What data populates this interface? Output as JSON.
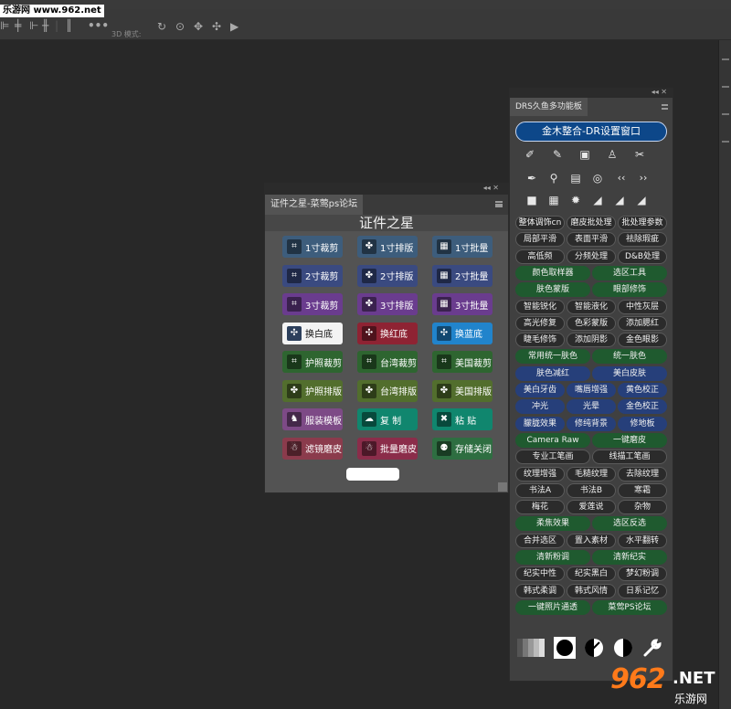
{
  "watermark_top": "乐游网 www.962.net",
  "options_bar": {
    "mode_label": "3D 模式:"
  },
  "panel1": {
    "tab": "证件之星-菜莺ps论坛",
    "title": "证件之星",
    "rows": [
      [
        {
          "label": "1寸裁剪",
          "color": "#3d5d7c",
          "icon": "crop-icon"
        },
        {
          "label": "1寸排版",
          "color": "#3d5d7c",
          "icon": "layout-icon"
        },
        {
          "label": "1寸批量",
          "color": "#3d5d7c",
          "icon": "batch-icon"
        }
      ],
      [
        {
          "label": "2寸裁剪",
          "color": "#3a4a80",
          "icon": "crop-icon"
        },
        {
          "label": "2寸排版",
          "color": "#3a4a80",
          "icon": "layout-icon"
        },
        {
          "label": "2寸批量",
          "color": "#3a4a80",
          "icon": "batch-icon"
        }
      ],
      [
        {
          "label": "3寸裁剪",
          "color": "#6a3c8e",
          "icon": "crop-icon"
        },
        {
          "label": "3寸排版",
          "color": "#6a3c8e",
          "icon": "layout-icon"
        },
        {
          "label": "3寸批量",
          "color": "#6a3c8e",
          "icon": "batch-icon"
        }
      ],
      [
        {
          "label": "换白底",
          "color": "#f3f3f3",
          "text": "#111",
          "icon": "swap-white-icon"
        },
        {
          "label": "换红底",
          "color": "#8e2333",
          "icon": "swap-red-icon"
        },
        {
          "label": "换蓝底",
          "color": "#2184cc",
          "icon": "swap-blue-icon"
        }
      ],
      [
        {
          "label": "护照裁剪",
          "color": "#2e6530",
          "icon": "crop-icon"
        },
        {
          "label": "台湾裁剪",
          "color": "#2e6530",
          "icon": "crop-icon"
        },
        {
          "label": "美国裁剪",
          "color": "#2e6530",
          "icon": "crop-icon"
        }
      ],
      [
        {
          "label": "护照排版",
          "color": "#526e2d",
          "icon": "layout-icon"
        },
        {
          "label": "台湾排版",
          "color": "#526e2d",
          "icon": "layout-icon"
        },
        {
          "label": "美国排版",
          "color": "#526e2d",
          "icon": "layout-icon"
        }
      ],
      [
        {
          "label": "服装模板",
          "color": "#7d4a86",
          "icon": "clothes-icon"
        },
        {
          "label": "复  制",
          "color": "#10866e",
          "icon": "copy-icon"
        },
        {
          "label": "粘  贴",
          "color": "#10866e",
          "icon": "paste-icon"
        }
      ],
      [
        {
          "label": "滤镜磨皮",
          "color": "#8b3b4c",
          "icon": "filter-icon"
        },
        {
          "label": "批量磨皮",
          "color": "#8b2d4a",
          "icon": "filter-icon"
        },
        {
          "label": "存储关闭",
          "color": "#2e6e41",
          "icon": "save-close-icon"
        }
      ]
    ]
  },
  "panel2": {
    "tab": "DRS久鱼多功能板",
    "top_button": "金木整合-DR设置窗口",
    "tool_icons": [
      [
        "brush-icon",
        "pen-icon",
        "chip-icon",
        "stamp-icon",
        "mask-icon"
      ],
      [
        "eyedropper-icon",
        "magnifier-icon",
        "film-icon",
        "target-icon",
        "back-icon",
        "forward-icon"
      ],
      [
        "square-icon",
        "gradient-icon",
        "sparkle-icon",
        "histogram-icon",
        "histogram2-icon",
        "histogram3-icon"
      ]
    ],
    "tool_glyphs": [
      [
        "✐",
        "✎",
        "▣",
        "♙",
        "✂"
      ],
      [
        "✒",
        "⚲",
        "▤",
        "◎",
        "‹‹",
        "››"
      ],
      [
        "■",
        "▦",
        "✹",
        "◢",
        "◢",
        "◢"
      ]
    ],
    "rows": [
      {
        "style": "dark",
        "items": [
          "整体调饰cn",
          "磨皮批处理",
          "批处理参数"
        ]
      },
      {
        "style": "dark",
        "items": [
          "局部平滑",
          "表面平滑",
          "祛除瑕疵"
        ]
      },
      {
        "style": "dark",
        "items": [
          "高低频",
          "分频处理",
          "D&B处理"
        ]
      },
      {
        "style": "green",
        "items": [
          "颜色取样器",
          "选区工具"
        ]
      },
      {
        "style": "green",
        "items": [
          "肤色蒙版",
          "眼部修饰"
        ]
      },
      {
        "style": "dark",
        "items": [
          "智能锐化",
          "智能液化",
          "中性灰层"
        ]
      },
      {
        "style": "dark",
        "items": [
          "高光修复",
          "色彩蒙版",
          "添加腮红"
        ]
      },
      {
        "style": "dark",
        "items": [
          "睫毛修饰",
          "添加阴影",
          "金色眼影"
        ]
      },
      {
        "style": "green",
        "items": [
          "常用统一肤色",
          "统一肤色"
        ]
      },
      {
        "style": "navy",
        "items": [
          "肤色减红",
          "美白皮肤"
        ]
      },
      {
        "style": "navy",
        "items": [
          "美白牙齿",
          "嘴唇增强",
          "黄色校正"
        ]
      },
      {
        "style": "navy",
        "items": [
          "冲光",
          "光晕",
          "金色校正"
        ]
      },
      {
        "style": "navy",
        "items": [
          "朦胧效果",
          "修纯背景",
          "修地板"
        ]
      },
      {
        "style": "green",
        "items": [
          "Camera Raw",
          "一键磨皮"
        ]
      },
      {
        "style": "dark",
        "items": [
          "专业工笔画",
          "线描工笔画"
        ]
      },
      {
        "style": "dark",
        "items": [
          "纹理增强",
          "毛糙纹理",
          "去除纹理"
        ]
      },
      {
        "style": "dark",
        "items": [
          "书法A",
          "书法B",
          "寒霜"
        ]
      },
      {
        "style": "dark",
        "items": [
          "梅花",
          "爱莲说",
          "杂物"
        ]
      },
      {
        "style": "green",
        "items": [
          "柔焦效果",
          "选区反选"
        ]
      },
      {
        "style": "dark",
        "items": [
          "合并选区",
          "置入素材",
          "水平翻转"
        ]
      },
      {
        "style": "green",
        "items": [
          "清新粉调",
          "清新纪实"
        ]
      },
      {
        "style": "dark",
        "items": [
          "纪实中性",
          "纪实黑白",
          "梦幻粉调"
        ]
      },
      {
        "style": "dark",
        "items": [
          "韩式柔调",
          "韩式风情",
          "日系记忆"
        ]
      },
      {
        "style": "green",
        "items": [
          "一键照片通透",
          "菜莺PS论坛"
        ]
      }
    ],
    "bottom_icons": [
      "grayscale-strip-icon",
      "black-circle-icon",
      "half-contrast-icon",
      "half-circle-icon",
      "wrench-icon"
    ]
  },
  "watermark_bottom": {
    "number": "962",
    "net": ".NET",
    "cn": "乐游网"
  },
  "colors": {
    "accent_blue": "#0d4789",
    "green": "#1f5a2f",
    "navy": "#263f7a",
    "workspace": "#282828"
  }
}
